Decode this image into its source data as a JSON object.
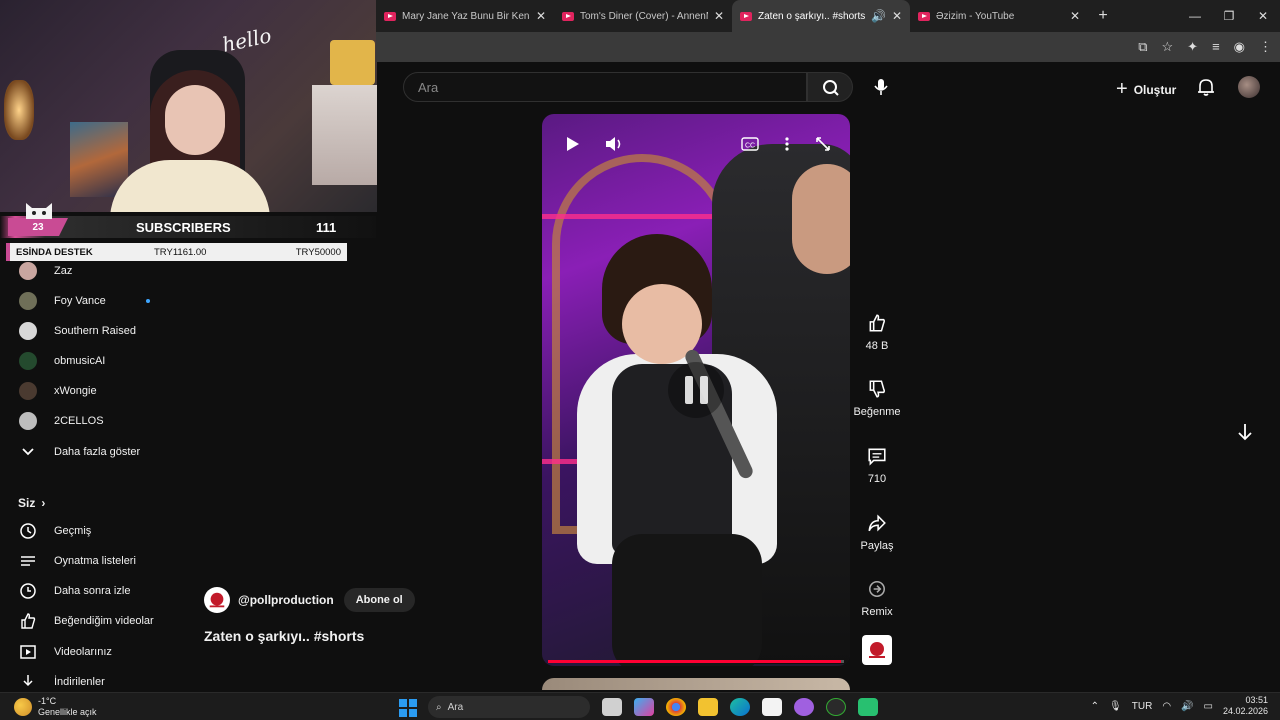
{
  "browser": {
    "tabs": [
      {
        "title": "Mary Jane Yaz Bunu Bir Kenara",
        "active": false
      },
      {
        "title": "Tom's Diner (Cover) - AnnenMa",
        "active": false
      },
      {
        "title": "Zaten o şarkıyı.. #shorts - Yo",
        "active": true
      },
      {
        "title": "Əzizim - YouTube",
        "active": false
      }
    ],
    "new_tab": "+",
    "window_controls": {
      "minimize": "—",
      "maximize": "❐",
      "close": "✕"
    }
  },
  "youtube": {
    "search_placeholder": "Ara",
    "create_label": "Oluştur"
  },
  "overlay": {
    "hello": "hello",
    "subs_count_badge": "23",
    "subs_label": "SUBSCRIBERS",
    "subs_number": "111",
    "donate_label": "ESİNDA DESTEK",
    "donate_current": "TRY1161.00",
    "donate_goal": "TRY50000",
    "donate_progress_fraction": 0.023
  },
  "sidebar": {
    "channels": [
      {
        "name": "Zaz",
        "color": "#c9a6a0"
      },
      {
        "name": "Foy Vance",
        "color": "#6f6f58",
        "new": true
      },
      {
        "name": "Southern Raised",
        "color": "#d8d8d8"
      },
      {
        "name": "obmusicAI",
        "color": "#244a2e"
      },
      {
        "name": "xWongie",
        "color": "#4a3a30"
      },
      {
        "name": "2CELLOS",
        "color": "#bdbdbd"
      }
    ],
    "show_more": "Daha fazla göster",
    "section_you": "Siz",
    "you_items": [
      {
        "label": "Geçmiş",
        "icon": "history-icon"
      },
      {
        "label": "Oynatma listeleri",
        "icon": "playlist-icon"
      },
      {
        "label": "Daha sonra izle",
        "icon": "clock-icon"
      },
      {
        "label": "Beğendiğim videolar",
        "icon": "thumbs-up-icon"
      },
      {
        "label": "Videolarınız",
        "icon": "video-icon"
      },
      {
        "label": "İndirilenler",
        "icon": "download-icon"
      }
    ]
  },
  "short": {
    "channel_handle": "@pollproduction",
    "subscribe_label": "Abone ol",
    "title": "Zaten o şarkıyı.. #shorts",
    "progress_fraction": 0.99
  },
  "actions": {
    "likes": "48 B",
    "dislike": "Beğenme",
    "comments": "710",
    "share": "Paylaş",
    "remix": "Remix"
  },
  "taskbar": {
    "temperature": "-1°C",
    "weather_desc": "Genellikle açık",
    "search_placeholder": "Ara",
    "language": "TUR",
    "time": "03:51",
    "date": "24.02.2026"
  }
}
